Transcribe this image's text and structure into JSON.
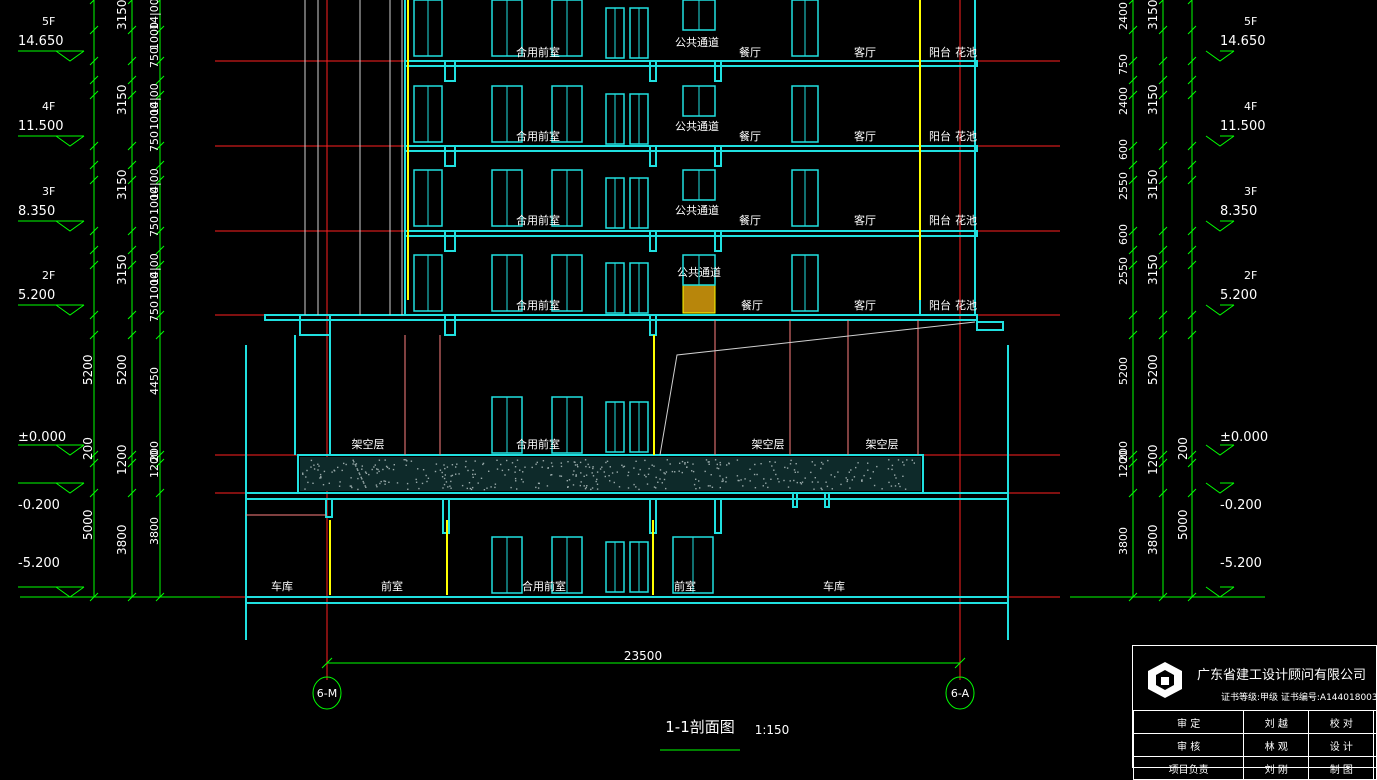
{
  "colors": {
    "background": "#000000",
    "level_line": "#ff2020",
    "dimension": "#00ff00",
    "structure": "#20e0e0",
    "label": "#ffffff",
    "highlight": "#ffff00",
    "column": "#ff8080"
  },
  "drawing": {
    "title": "1-1剖面图",
    "scale": "1:150",
    "overall_width": "23500",
    "axis_left": "6-M",
    "axis_right": "6-A"
  },
  "levels_left": [
    {
      "floor": "5F",
      "elev": "14.650"
    },
    {
      "floor": "4F",
      "elev": "11.500"
    },
    {
      "floor": "3F",
      "elev": "8.350"
    },
    {
      "floor": "2F",
      "elev": "5.200"
    },
    {
      "floor": "",
      "elev": "±0.000"
    },
    {
      "floor": "",
      "elev": "-0.200"
    },
    {
      "floor": "",
      "elev": "-5.200"
    }
  ],
  "levels_right": [
    {
      "floor": "5F",
      "elev": "14.650"
    },
    {
      "floor": "4F",
      "elev": "11.500"
    },
    {
      "floor": "3F",
      "elev": "8.350"
    },
    {
      "floor": "2F",
      "elev": "5.200"
    },
    {
      "floor": "",
      "elev": "±0.000"
    },
    {
      "floor": "",
      "elev": "-0.200"
    },
    {
      "floor": "",
      "elev": "-5.200"
    }
  ],
  "dims_left": {
    "outer": [
      "5000",
      "200",
      "5200"
    ],
    "floor": [
      "3150",
      "3150",
      "3150",
      "3150",
      "5200",
      "3800",
      "1200"
    ],
    "inner": [
      "14|00",
      "750",
      "1000",
      "14|00",
      "750",
      "1000",
      "14|00",
      "750",
      "1000",
      "14|00",
      "750",
      "1000",
      "4450",
      "200",
      "1200",
      "3800"
    ]
  },
  "dims_right": {
    "outer": [
      "200",
      "5000"
    ],
    "floor": [
      "3150",
      "3150",
      "3150",
      "3150",
      "5200",
      "1200",
      "3800"
    ],
    "inner": [
      "2400",
      "750",
      "2400",
      "600",
      "2550",
      "600",
      "2550",
      "5200",
      "200",
      "1200",
      "3800"
    ]
  },
  "rooms": {
    "upper_floor": [
      "合用前室",
      "公共通道",
      "餐厅",
      "客厅",
      "阳台",
      "花池"
    ],
    "floor2": [
      "合用前室",
      "公共通道",
      "餐厅",
      "客厅",
      "阳台",
      "花池"
    ],
    "ground": [
      "架空层",
      "合用前室",
      "架空层",
      "架空层"
    ],
    "basement": [
      "车库",
      "前室",
      "合用前室",
      "前室",
      "车库"
    ]
  },
  "title_block": {
    "company": "广东省建工设计顾问有限公司",
    "cert": "证书等级:甲级  证书编号:A144018003",
    "rows": [
      [
        "审 定",
        "刘 越",
        "校 对",
        ""
      ],
      [
        "审 核",
        "林 观",
        "设 计",
        ""
      ],
      [
        "项目负责",
        "刘 刚",
        "制 图",
        ""
      ]
    ]
  }
}
